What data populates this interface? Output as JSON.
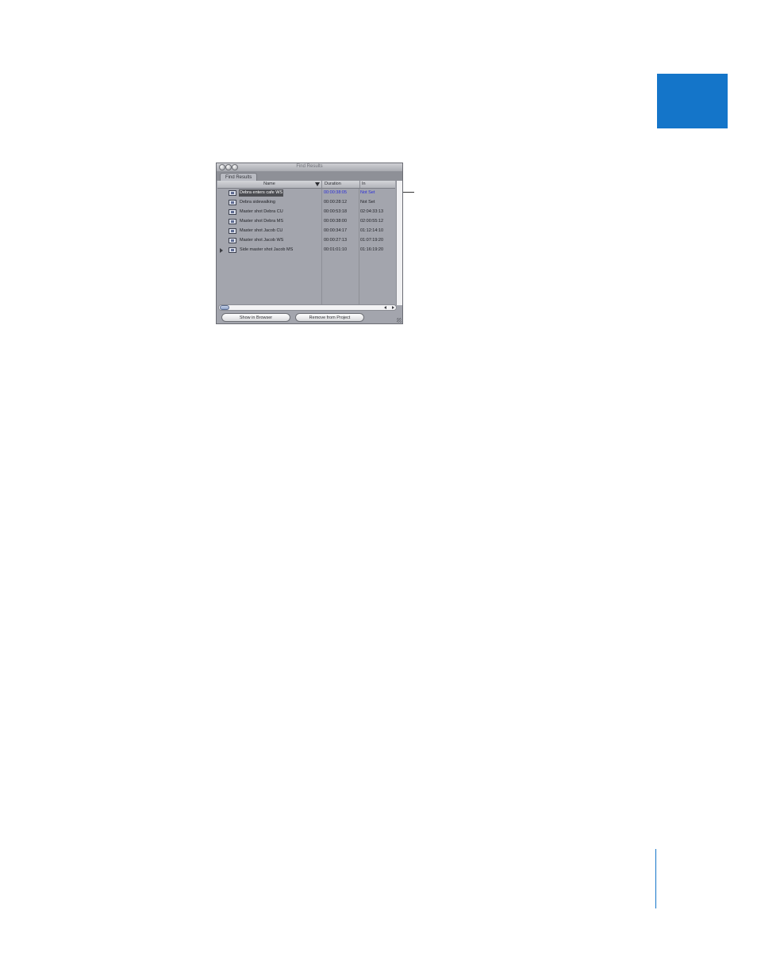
{
  "colors": {
    "accent": "#1475c9",
    "selection": "#4c4d52",
    "highlight_text": "#2b2fd8"
  },
  "window": {
    "title": "Find Results"
  },
  "tabs": [
    {
      "label": "Find Results"
    }
  ],
  "columns": {
    "name": "Name",
    "duration": "Duration",
    "in": "In"
  },
  "rows": [
    {
      "name": "Debra enters cafe WS",
      "duration": "00:00:38:05",
      "in": "Not Set",
      "selected": true,
      "icon": "clip-icon"
    },
    {
      "name": "Debra sidewalking",
      "duration": "00:00:28:12",
      "in": "Not Set",
      "icon": "clip-icon"
    },
    {
      "name": "Master shot Debra CU",
      "duration": "00:00:53:18",
      "in": "02:04:33:13",
      "icon": "clip-icon"
    },
    {
      "name": "Master shot Debra MS",
      "duration": "00:00:38:00",
      "in": "02:00:55:12",
      "icon": "clip-icon"
    },
    {
      "name": "Master shot Jacob CU",
      "duration": "00:00:34:17",
      "in": "01:12:14:10",
      "icon": "clip-icon"
    },
    {
      "name": "Master shot Jacob WS",
      "duration": "00:00:27:13",
      "in": "01:07:19:20",
      "icon": "clip-icon"
    },
    {
      "name": "Side master shot Jacob MS",
      "duration": "00:01:01:10",
      "in": "01:16:19:20",
      "has_disclosure": true,
      "icon": "clip-icon"
    }
  ],
  "buttons": {
    "show_in_browser": "Show in Browser",
    "remove_from_project": "Remove from Project"
  }
}
